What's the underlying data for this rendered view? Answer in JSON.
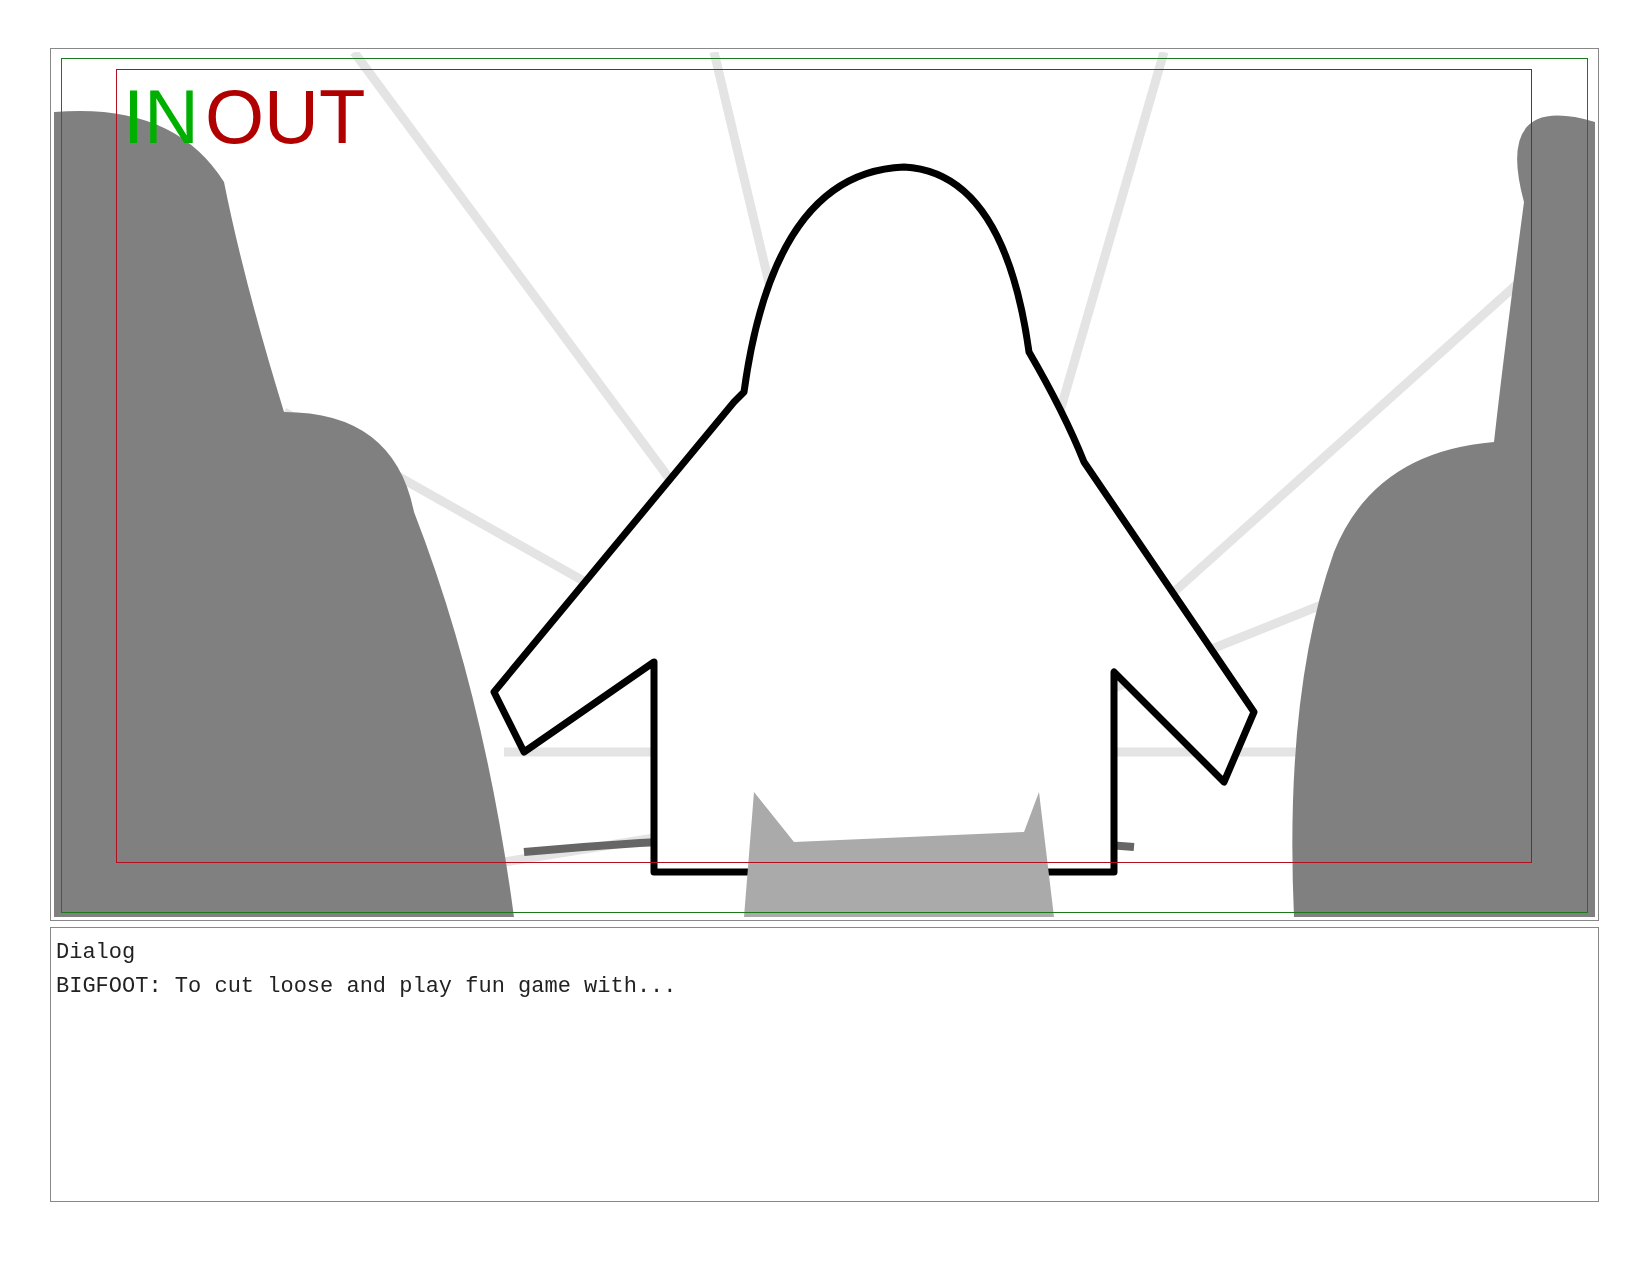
{
  "panel": {
    "overlay_labels": [
      {
        "text": "IN",
        "color": "#00b000"
      },
      {
        "text": "OUT",
        "color": "#b00000"
      }
    ]
  },
  "dialog": {
    "heading": "Dialog",
    "text": "BIGFOOT: To cut loose and play fun game with..."
  }
}
